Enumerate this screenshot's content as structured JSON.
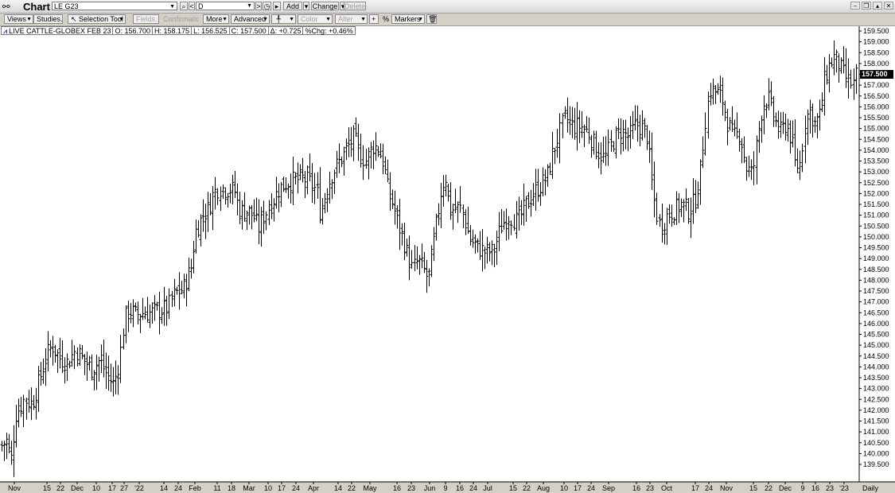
{
  "window": {
    "title": "Chart"
  },
  "symbol": {
    "value": "LE G23"
  },
  "period": {
    "value": "D"
  },
  "buttons": {
    "add": "Add",
    "change": "Change",
    "delete": "Delete"
  },
  "toolbar": {
    "views": "Views",
    "studies": "Studies...",
    "selection_tool": "Selection Tool",
    "fields": "Fields...",
    "confirmation": "Confirmation",
    "more": "More",
    "advanced": "Advanced",
    "color": "Color",
    "alter": "Alter",
    "percent": "%",
    "markers": "Markers"
  },
  "info": {
    "name": "LIVE CATTLE-GLOBEX FEB 23",
    "open": "O: 156.700",
    "high": "H: 158.175",
    "low": "L: 156.525",
    "close": "C: 157.500",
    "change": "Δ: +0.725",
    "pct_change": "%Chg: +0.46%"
  },
  "last_price_label": "157.500",
  "chart_data": {
    "type": "ohlc",
    "instrument": "LIVE CATTLE-GLOBEX FEB 23",
    "interval": "Daily",
    "ylim": [
      139.25,
      159.5
    ],
    "y_ticks": [
      "159.500",
      "159.000",
      "158.500",
      "158.000",
      "157.500",
      "157.000",
      "156.500",
      "156.000",
      "155.500",
      "155.000",
      "154.500",
      "154.000",
      "153.500",
      "153.000",
      "152.500",
      "152.000",
      "151.500",
      "151.000",
      "150.500",
      "150.000",
      "149.500",
      "149.000",
      "148.500",
      "148.000",
      "147.500",
      "147.000",
      "146.500",
      "146.000",
      "145.500",
      "145.000",
      "144.500",
      "144.000",
      "143.500",
      "143.000",
      "142.500",
      "142.000",
      "141.500",
      "141.000",
      "140.500",
      "140.000",
      "139.500"
    ],
    "x_labels": [
      "Nov",
      "15",
      "22",
      "Dec",
      "10",
      "17",
      "27",
      "'22",
      "14",
      "24",
      "Feb",
      "11",
      "18",
      "Mar",
      "10",
      "17",
      "24",
      "Apr",
      "14",
      "22",
      "May",
      "16",
      "23",
      "Jun",
      "9",
      "16",
      "24",
      "Jul",
      "15",
      "22",
      "Aug",
      "10",
      "17",
      "24",
      "Sep",
      "16",
      "23",
      "Oct",
      "17",
      "24",
      "Nov",
      "15",
      "22",
      "Dec",
      "9",
      "16",
      "23",
      "'23",
      "Daily"
    ],
    "anchors": [
      [
        0,
        140.3
      ],
      [
        8,
        140.6
      ],
      [
        14,
        139.7
      ],
      [
        20,
        141.8
      ],
      [
        30,
        142.5
      ],
      [
        40,
        142.3
      ],
      [
        50,
        143.5
      ],
      [
        58,
        144.5
      ],
      [
        65,
        145.0
      ],
      [
        75,
        144.4
      ],
      [
        85,
        144.2
      ],
      [
        95,
        144.8
      ],
      [
        105,
        144.3
      ],
      [
        115,
        143.9
      ],
      [
        125,
        144.3
      ],
      [
        135,
        143.6
      ],
      [
        143,
        143.2
      ],
      [
        150,
        144.3
      ],
      [
        156,
        146.2
      ],
      [
        162,
        146.6
      ],
      [
        170,
        146.4
      ],
      [
        180,
        146.5
      ],
      [
        190,
        146.5
      ],
      [
        200,
        146.6
      ],
      [
        210,
        146.7
      ],
      [
        220,
        147.4
      ],
      [
        230,
        147.6
      ],
      [
        240,
        148.6
      ],
      [
        245,
        150.2
      ],
      [
        255,
        151.0
      ],
      [
        262,
        151.3
      ],
      [
        268,
        152.0
      ],
      [
        275,
        152.3
      ],
      [
        282,
        152.2
      ],
      [
        290,
        152.2
      ],
      [
        295,
        152.1
      ],
      [
        300,
        151.2
      ],
      [
        310,
        151.2
      ],
      [
        318,
        151.0
      ],
      [
        325,
        150.4
      ],
      [
        332,
        151.0
      ],
      [
        340,
        151.5
      ],
      [
        350,
        152.2
      ],
      [
        360,
        152.5
      ],
      [
        370,
        152.6
      ],
      [
        380,
        152.7
      ],
      [
        390,
        152.5
      ],
      [
        398,
        152.1
      ],
      [
        402,
        151.1
      ],
      [
        410,
        152.2
      ],
      [
        418,
        153.0
      ],
      [
        425,
        153.4
      ],
      [
        432,
        153.8
      ],
      [
        438,
        154.2
      ],
      [
        445,
        154.6
      ],
      [
        452,
        153.8
      ],
      [
        460,
        153.5
      ],
      [
        468,
        154.2
      ],
      [
        475,
        154.1
      ],
      [
        482,
        153.4
      ],
      [
        488,
        152.0
      ],
      [
        494,
        151.5
      ],
      [
        500,
        150.6
      ],
      [
        506,
        150.0
      ],
      [
        512,
        149.2
      ],
      [
        518,
        148.5
      ],
      [
        525,
        148.9
      ],
      [
        532,
        148.5
      ],
      [
        538,
        148.0
      ],
      [
        543,
        149.3
      ],
      [
        550,
        151.0
      ],
      [
        555,
        152.3
      ],
      [
        560,
        152.8
      ],
      [
        565,
        151.2
      ],
      [
        572,
        151.3
      ],
      [
        580,
        151.3
      ],
      [
        590,
        149.9
      ],
      [
        600,
        149.5
      ],
      [
        610,
        149.3
      ],
      [
        620,
        149.3
      ],
      [
        630,
        150.5
      ],
      [
        640,
        151.0
      ],
      [
        650,
        150.7
      ],
      [
        660,
        151.4
      ],
      [
        670,
        152.0
      ],
      [
        680,
        152.4
      ],
      [
        688,
        152.8
      ],
      [
        695,
        153.9
      ],
      [
        702,
        154.7
      ],
      [
        710,
        155.5
      ],
      [
        720,
        155.1
      ],
      [
        730,
        155.1
      ],
      [
        740,
        154.8
      ],
      [
        750,
        154.0
      ],
      [
        760,
        153.6
      ],
      [
        770,
        154.4
      ],
      [
        780,
        154.9
      ],
      [
        790,
        154.6
      ],
      [
        800,
        155.2
      ],
      [
        808,
        155.0
      ],
      [
        814,
        154.6
      ],
      [
        818,
        152.9
      ],
      [
        824,
        151.2
      ],
      [
        830,
        150.4
      ],
      [
        838,
        151.0
      ],
      [
        846,
        151.2
      ],
      [
        856,
        151.5
      ],
      [
        866,
        151.2
      ],
      [
        874,
        151.7
      ],
      [
        880,
        152.9
      ],
      [
        886,
        155.3
      ],
      [
        892,
        156.8
      ],
      [
        900,
        156.7
      ],
      [
        908,
        156.3
      ],
      [
        914,
        155.3
      ],
      [
        922,
        154.6
      ],
      [
        930,
        154.8
      ],
      [
        938,
        153.2
      ],
      [
        946,
        152.9
      ],
      [
        952,
        154.6
      ],
      [
        958,
        156.1
      ],
      [
        965,
        156.4
      ],
      [
        972,
        155.6
      ],
      [
        980,
        154.8
      ],
      [
        988,
        155.2
      ],
      [
        995,
        154.5
      ],
      [
        1000,
        153.2
      ],
      [
        1006,
        153.4
      ],
      [
        1012,
        155.5
      ],
      [
        1018,
        155.8
      ],
      [
        1024,
        155.2
      ],
      [
        1030,
        155.6
      ],
      [
        1036,
        157.2
      ],
      [
        1042,
        157.9
      ],
      [
        1048,
        158.3
      ],
      [
        1054,
        158.0
      ],
      [
        1060,
        157.5
      ],
      [
        1066,
        157.2
      ],
      [
        1072,
        157.0
      ],
      [
        1076,
        157.5
      ]
    ]
  }
}
